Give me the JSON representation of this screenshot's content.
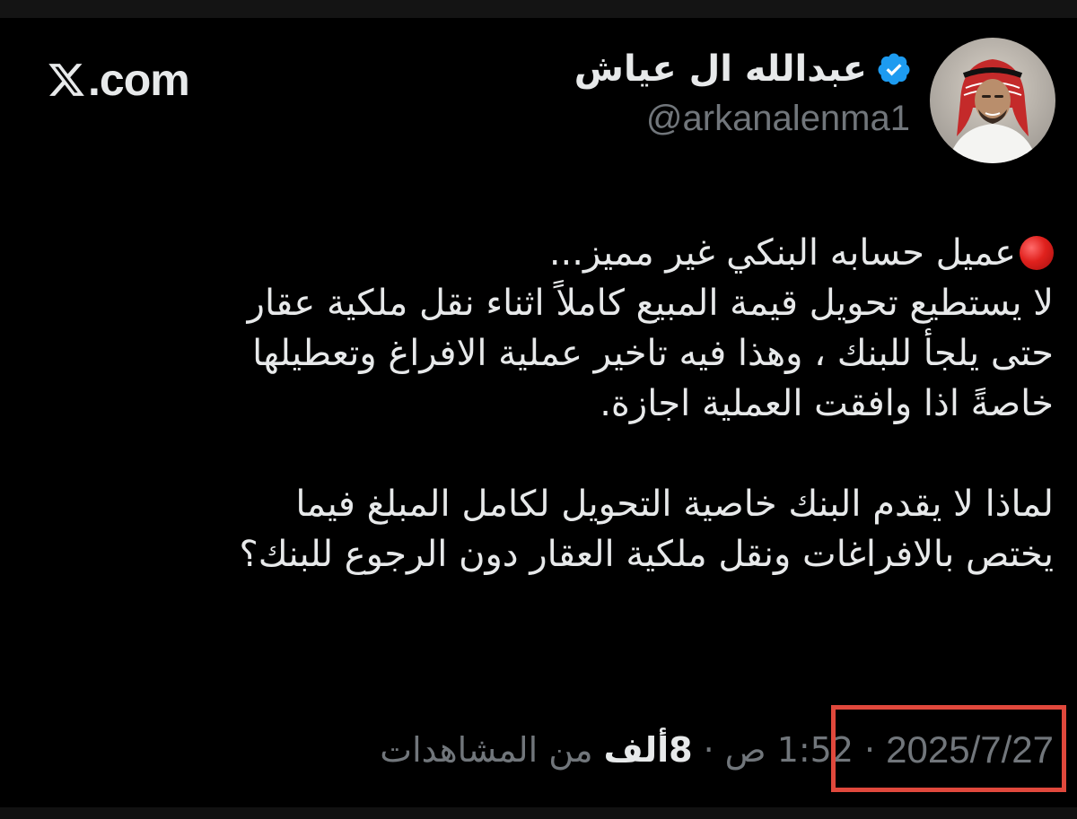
{
  "brand": {
    "label": ".com",
    "icon": "x-logo-icon"
  },
  "author": {
    "display_name": "عبدالله ال عياش",
    "handle": "@arkanalenma1",
    "verified_icon": "verified-badge-icon",
    "verified_color": "#1d9bf0"
  },
  "tweet": {
    "lead_icon": "red-circle-icon",
    "lines": [
      "عميل حسابه البنكي غير مميز...",
      "لا يستطيع تحويل قيمة المبيع كاملاً اثناء نقل ملكية عقار",
      "حتى يلجأ للبنك ، وهذا فيه تاخير عملية الافراغ وتعطيلها",
      "خاصةً اذا وافقت العملية اجازة."
    ],
    "lines_2": [
      "لماذا لا يقدم البنك خاصية التحويل لكامل المبلغ فيما",
      "يختص بالافراغات ونقل ملكية العقار دون الرجوع للبنك؟"
    ]
  },
  "meta": {
    "date": "2025/7/27",
    "separator": "·",
    "time": "1:52 ص",
    "views_count": "8ألف",
    "views_label": "من المشاهدات"
  },
  "colors": {
    "background": "#000000",
    "text": "#e7e9ea",
    "muted": "#71767b",
    "highlight_box": "#e0483c"
  }
}
